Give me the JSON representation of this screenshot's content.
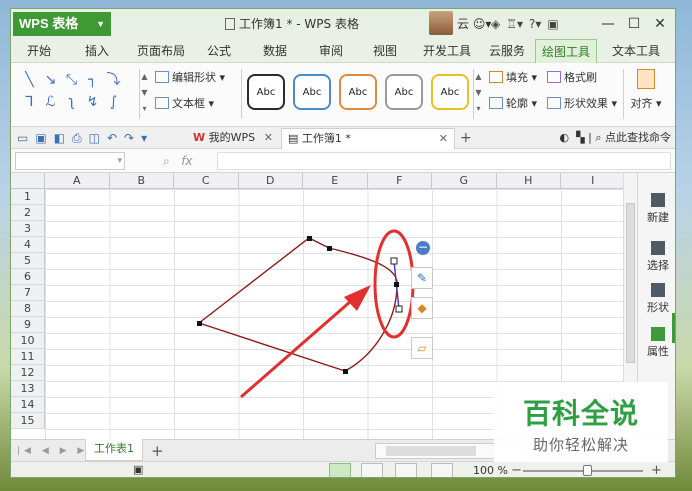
{
  "app": {
    "logo_text": "WPS 表格",
    "window_title": "工作簿1 * - WPS 表格",
    "cloud_label": "云",
    "window_controls": [
      "—",
      "☐",
      "✕"
    ]
  },
  "menu_tabs": [
    "开始",
    "插入",
    "页面布局",
    "公式",
    "数据",
    "审阅",
    "视图",
    "开发工具",
    "云服务",
    "绘图工具",
    "文本工具"
  ],
  "active_menu_tab": "绘图工具",
  "ribbon": {
    "edit_shape": "编辑形状",
    "text_box": "文本框",
    "style_samples": [
      {
        "label": "Abc",
        "border": "#2b2b2b"
      },
      {
        "label": "Abc",
        "border": "#4a8bc8"
      },
      {
        "label": "Abc",
        "border": "#e28a3a"
      },
      {
        "label": "Abc",
        "border": "#9a9a9a"
      },
      {
        "label": "Abc",
        "border": "#e7c02a"
      }
    ],
    "fill": "填充",
    "format_painter": "格式刷",
    "outline": "轮廓",
    "shape_effects": "形状效果",
    "align": "对齐"
  },
  "doc_tabs": {
    "my_wps": "我的WPS",
    "workbook": "工作簿1 *",
    "search_label": "点此查找命令"
  },
  "formula_bar": {
    "fx_label": "fx"
  },
  "columns": [
    "A",
    "B",
    "C",
    "D",
    "E",
    "F",
    "G",
    "H",
    "I"
  ],
  "rows": [
    "1",
    "2",
    "3",
    "4",
    "5",
    "6",
    "7",
    "8",
    "9",
    "10",
    "11",
    "12",
    "13",
    "14",
    "15"
  ],
  "task_pane": [
    "新建",
    "选择",
    "形状",
    "属性"
  ],
  "sheet_tab": "工作表1",
  "zoom": "100 %",
  "watermark": {
    "title": "百科全说",
    "subtitle": "助你轻松解决"
  },
  "colors": {
    "accent_green": "#3f9a36",
    "shape_line": "#8b1a1a",
    "highlight_red": "#e03030"
  }
}
